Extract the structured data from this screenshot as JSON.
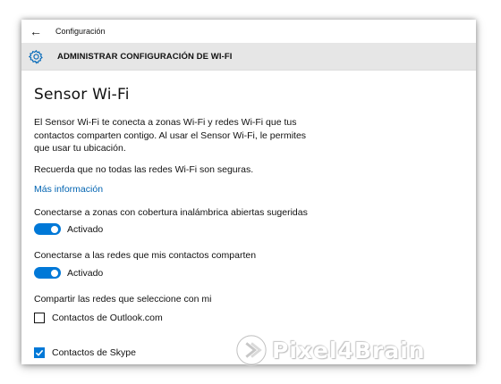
{
  "window": {
    "app_title": "Configuración"
  },
  "header": {
    "title": "ADMINISTRAR CONFIGURACIÓN DE WI-FI",
    "icon": "gear-icon"
  },
  "section": {
    "title": "Sensor Wi-Fi",
    "description": "El Sensor Wi-Fi te conecta a zonas Wi-Fi y redes Wi-Fi que tus contactos comparten contigo. Al usar el Sensor Wi-Fi, le permites que usar tu ubicación.",
    "warning": "Recuerda que no todas las redes Wi-Fi son seguras.",
    "more_link": "Más información"
  },
  "settings": {
    "open_hotspots": {
      "label": "Conectarse a zonas con cobertura inalámbrica abiertas sugeridas",
      "state": "Activado",
      "on": true
    },
    "contact_networks": {
      "label": "Conectarse a las redes que mis contactos comparten",
      "state": "Activado",
      "on": true
    },
    "share_with": {
      "label": "Compartir las redes que seleccione con mi",
      "options": [
        {
          "label": "Contactos de Outlook.com",
          "checked": false
        },
        {
          "label": "Contactos de Skype",
          "checked": true
        }
      ]
    }
  },
  "watermark": {
    "text": "Pixel4Brain"
  },
  "colors": {
    "accent": "#0078d7",
    "link": "#0063b1",
    "header_bg": "#e6e6e6"
  }
}
